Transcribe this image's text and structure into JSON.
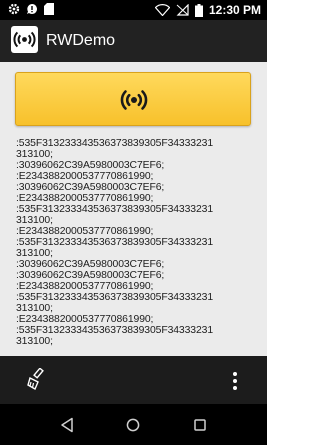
{
  "status_bar": {
    "left_icons": [
      "settings-icon",
      "alert-bubble-icon",
      "sd-card-icon"
    ],
    "right_icons": [
      "wifi-icon",
      "cellular-off-icon",
      "battery-icon"
    ],
    "time": "12:30 PM"
  },
  "app_bar": {
    "title": "RWDemo",
    "icon": "rfid-app-icon"
  },
  "main": {
    "scan_button_icon": "rfid-signal-icon",
    "log_lines": [
      ":535F313233343536373839305F34333231",
      "313100;",
      ":30396062C39A5980003C7EF6;",
      ":E2343882000537770861990;",
      ":30396062C39A5980003C7EF6;",
      ":E2343882000537770861990;",
      ":535F313233343536373839305F34333231",
      "313100;",
      ":E2343882000537770861990;",
      ":535F313233343536373839305F34333231",
      "313100;",
      ":30396062C39A5980003C7EF6;",
      ":30396062C39A5980003C7EF6;",
      ":E2343882000537770861990;",
      ":535F313233343536373839305F34333231",
      "313100;",
      ":E2343882000537770861990;",
      ":535F313233343536373839305F34333231",
      "313100;"
    ]
  },
  "bottom_bar": {
    "left_icon": "clean-brush-icon",
    "right_icon": "overflow-menu-icon"
  },
  "nav_bar": {
    "back_icon": "back-icon",
    "home_icon": "home-icon",
    "recents_icon": "recents-icon"
  }
}
